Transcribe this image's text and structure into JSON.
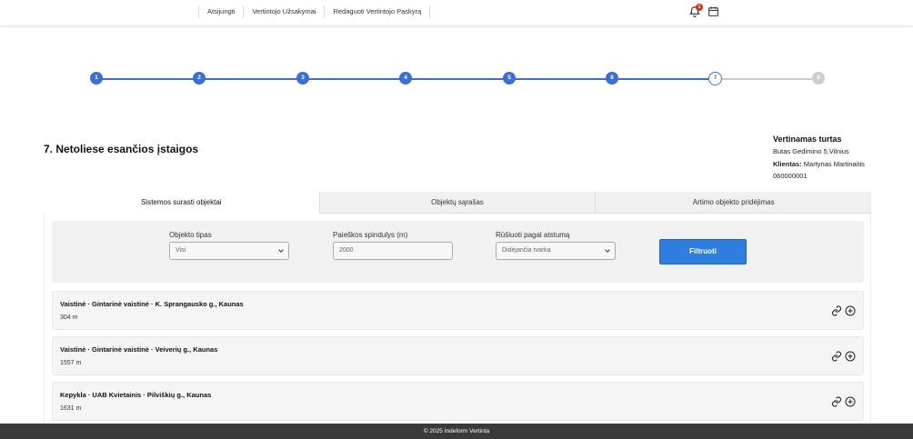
{
  "nav": {
    "items": [
      "Atsijungti",
      "Vertintojo Užsakymai",
      "Redaguoti Vertintojo Paskyrą"
    ],
    "notification_count": "1"
  },
  "stepper": {
    "steps": [
      "1",
      "2",
      "3",
      "4",
      "5",
      "6",
      "7",
      "8"
    ],
    "current_step": 7,
    "active_color": "#3b6fd4"
  },
  "page": {
    "title": "7. Netoliese esančios įstaigos"
  },
  "asset": {
    "title": "Vertinamas turtas",
    "address": "Butas Gedimino 5,Vilnius",
    "client_label": "Klientas:",
    "client_name": "Martynas Martinaitis",
    "code": "060000001"
  },
  "tabs": [
    "Sistemos surasti objektai",
    "Objektų sąrašas",
    "Artimo objekto pridėjimas"
  ],
  "filters": {
    "type_label": "Objekto tipas",
    "type_value": "Visi",
    "radius_label": "Paieškos spindulys (m)",
    "radius_value": "2000",
    "sort_label": "Rūšiuoti pagal atstumą",
    "sort_value": "Didėjančia tvarka",
    "button": "Filtruoti",
    "button_color": "#2f7de1"
  },
  "results": [
    {
      "title": "Vaistinė  · Gintarinė vaistinė  · K. Sprangausko g., Kaunas",
      "distance": "304 m"
    },
    {
      "title": "Vaistinė  · Gintarinė vaistinė  · Veiverių g., Kaunas",
      "distance": "1557 m"
    },
    {
      "title": "Kepykla  · UAB Kvietainis  · Pilviškių g., Kaunas",
      "distance": "1631 m"
    }
  ],
  "footer": {
    "text": "© 2025 Indeform Vertinta"
  }
}
